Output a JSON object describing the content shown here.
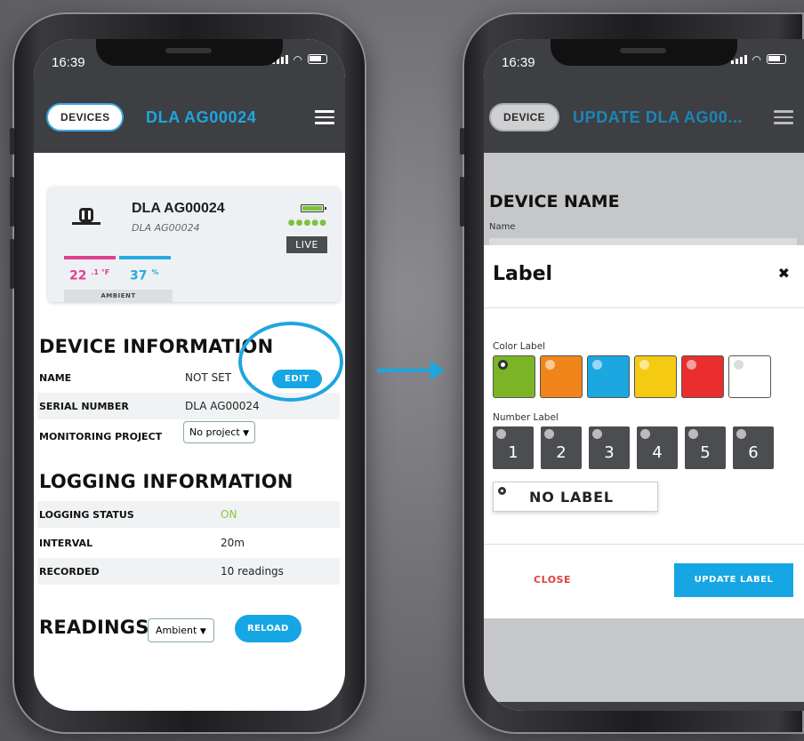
{
  "left_phone": {
    "status_time": "16:39",
    "header": {
      "back_label": "DEVICES",
      "title": "DLA AG00024"
    },
    "card": {
      "device_name": "DLA AG00024",
      "device_sub": "DLA AG00024",
      "battery_dots": "●●●●●",
      "live_label": "LIVE",
      "temp_value": "22",
      "temp_unit": ".1 °F",
      "hum_value": "37",
      "hum_unit": "%",
      "ambient_label": "AMBIENT",
      "colors": {
        "temp": "#e0408f",
        "humidity": "#26abe2",
        "battery": "#7dc23f"
      }
    },
    "device_info": {
      "title": "DEVICE INFORMATION",
      "name_key": "NAME",
      "name_value": "NOT SET",
      "edit_label": "EDIT",
      "serial_key": "SERIAL NUMBER",
      "serial_value": "DLA AG00024",
      "project_key": "MONITORING PROJECT",
      "project_value": "No project"
    },
    "logging_info": {
      "title": "LOGGING INFORMATION",
      "status_key": "LOGGING STATUS",
      "status_value": "ON",
      "interval_key": "INTERVAL",
      "interval_value": "20m",
      "recorded_key": "RECORDED",
      "recorded_value": "10 readings"
    },
    "readings": {
      "title": "READINGS",
      "select_value": "Ambient",
      "reload_label": "RELOAD"
    }
  },
  "right_phone": {
    "status_time": "16:39",
    "header": {
      "back_label": "DEVICE",
      "title": "UPDATE DLA AG00..."
    },
    "device_name_title": "DEVICE NAME",
    "name_label": "Name",
    "modal": {
      "title": "Label",
      "close_icon": "✖",
      "color_label": "Color Label",
      "colors": [
        "#7bb526",
        "#f1851c",
        "#1ba7df",
        "#f5ca12",
        "#ea2e2e",
        "#ffffff"
      ],
      "number_label": "Number Label",
      "numbers": [
        "1",
        "2",
        "3",
        "4",
        "5",
        "6"
      ],
      "no_label": "NO LABEL",
      "close_label": "CLOSE",
      "update_label": "UPDATE LABEL"
    }
  },
  "accent_color": "#1ea6e0"
}
